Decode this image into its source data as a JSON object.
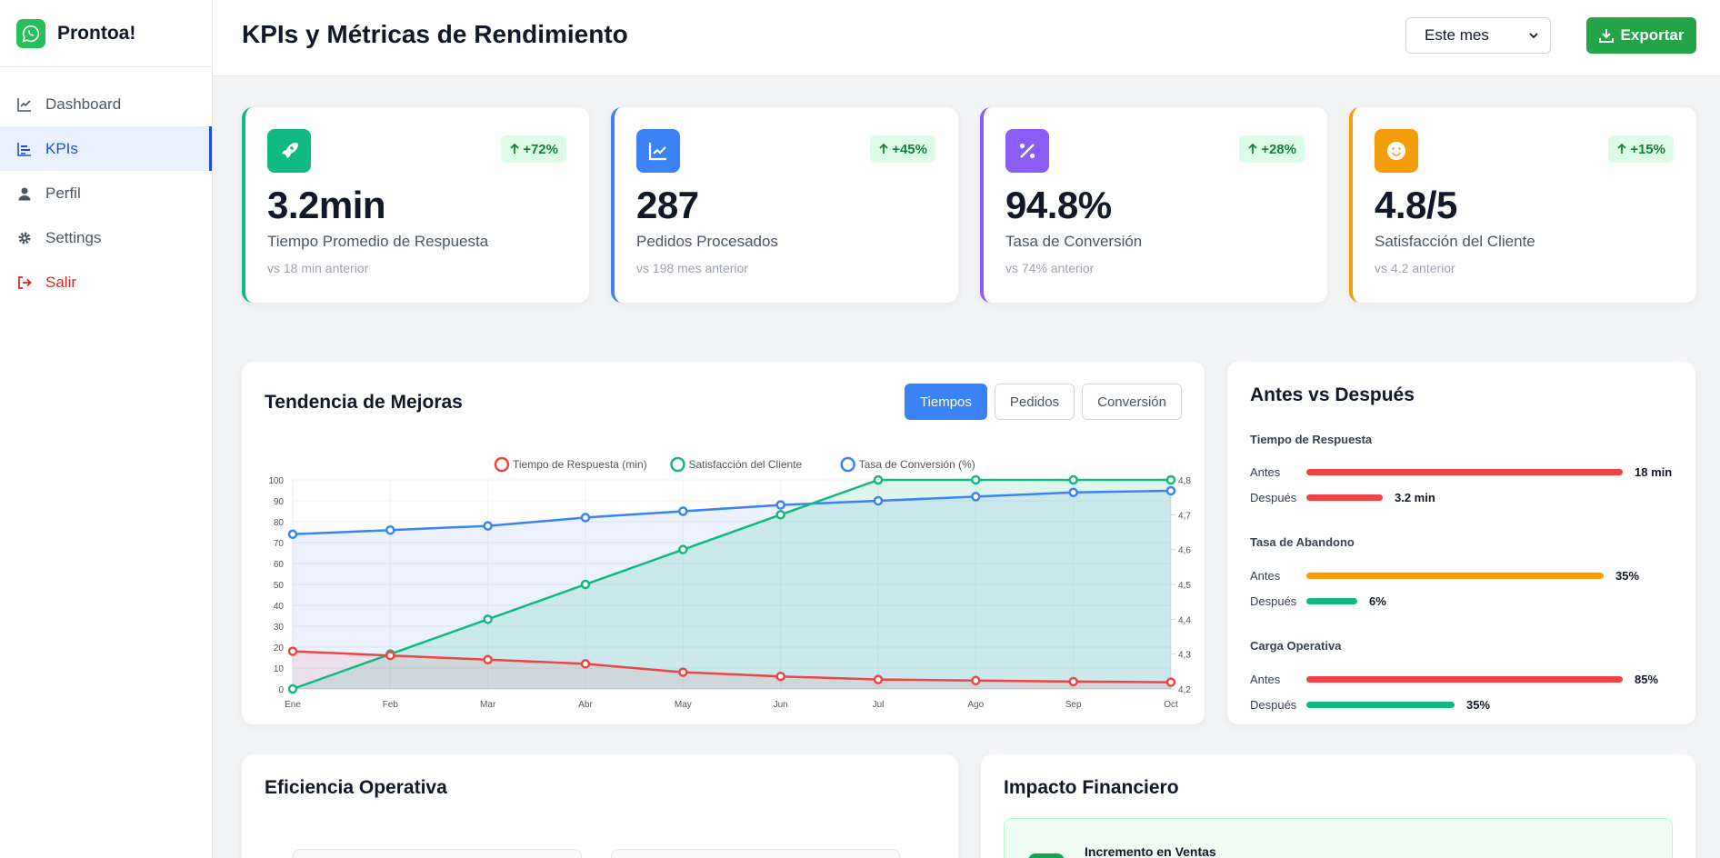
{
  "app": {
    "name": "Prontoa!"
  },
  "sidebar": {
    "items": [
      {
        "label": "Dashboard",
        "icon": "chart-line-icon",
        "active": false
      },
      {
        "label": "KPIs",
        "icon": "chart-bar-icon",
        "active": true
      },
      {
        "label": "Perfil",
        "icon": "user-icon",
        "active": false
      },
      {
        "label": "Settings",
        "icon": "gear-icon",
        "active": false
      },
      {
        "label": "Salir",
        "icon": "sign-out-icon",
        "active": false
      }
    ]
  },
  "header": {
    "title": "KPIs y Métricas de Rendimiento",
    "period_selected": "Este mes",
    "export_label": "Exportar"
  },
  "kpis": [
    {
      "value": "3.2min",
      "label": "Tiempo Promedio de Respuesta",
      "sub": "vs 18 min anterior",
      "badge": "+72%",
      "icon": "rocket-icon",
      "color": "#10b981"
    },
    {
      "value": "287",
      "label": "Pedidos Procesados",
      "sub": "vs 198 mes anterior",
      "badge": "+45%",
      "icon": "chart-line-icon",
      "color": "#3b82f6"
    },
    {
      "value": "94.8%",
      "label": "Tasa de Conversión",
      "sub": "vs 74% anterior",
      "badge": "+28%",
      "icon": "percent-icon",
      "color": "#8b5cf6"
    },
    {
      "value": "4.8/5",
      "label": "Satisfacción del Cliente",
      "sub": "vs 4.2 anterior",
      "badge": "+15%",
      "icon": "smile-icon",
      "color": "#f59e0b"
    }
  ],
  "trend": {
    "title": "Tendencia de Mejoras",
    "tabs": [
      "Tiempos",
      "Pedidos",
      "Conversión"
    ],
    "active_tab": "Tiempos"
  },
  "chart_data": {
    "type": "line",
    "categories": [
      "Ene",
      "Feb",
      "Mar",
      "Abr",
      "May",
      "Jun",
      "Jul",
      "Ago",
      "Sep",
      "Oct"
    ],
    "series": [
      {
        "name": "Tiempo de Respuesta (min)",
        "axis": "left",
        "color": "#ef4444",
        "values": [
          18,
          16,
          14,
          12,
          8,
          6,
          4.5,
          4,
          3.5,
          3.2
        ]
      },
      {
        "name": "Satisfacción del Cliente",
        "axis": "right",
        "color": "#10b981",
        "values": [
          4.2,
          4.3,
          4.4,
          4.5,
          4.6,
          4.7,
          4.8,
          4.8,
          4.8,
          4.8
        ]
      },
      {
        "name": "Tasa de Conversión (%)",
        "axis": "left",
        "color": "#3b82f6",
        "values": [
          74,
          76,
          78,
          82,
          85,
          88,
          90,
          92,
          94,
          94.8
        ]
      }
    ],
    "y_left": {
      "ticks": [
        "0",
        "10",
        "20",
        "30",
        "40",
        "50",
        "60",
        "70",
        "80",
        "90",
        "100"
      ],
      "ylim": [
        0,
        100
      ]
    },
    "y_right": {
      "ticks": [
        "4,2",
        "4,3",
        "4,4",
        "4,5",
        "4,6",
        "4,7",
        "4,8"
      ],
      "ylim": [
        4.2,
        4.8
      ]
    },
    "legend": "top-center",
    "grid": true
  },
  "comparison": {
    "title": "Antes vs Después",
    "sections": [
      {
        "label": "Tiempo de Respuesta",
        "before": {
          "label": "Antes",
          "value": "18 min",
          "fraction": 1.0,
          "color": "#ef4444"
        },
        "after": {
          "label": "Después",
          "value": "3.2 min",
          "fraction": 0.24,
          "color": "#ef4444"
        }
      },
      {
        "label": "Tasa de Abandono",
        "before": {
          "label": "Antes",
          "value": "35%",
          "fraction": 0.94,
          "color": "#f59e0b"
        },
        "after": {
          "label": "Después",
          "value": "6%",
          "fraction": 0.16,
          "color": "#10b981"
        }
      },
      {
        "label": "Carga Operativa",
        "before": {
          "label": "Antes",
          "value": "85%",
          "fraction": 1.0,
          "color": "#ef4444"
        },
        "after": {
          "label": "Después",
          "value": "35%",
          "fraction": 0.47,
          "color": "#10b981"
        }
      }
    ]
  },
  "efficiency": {
    "title": "Eficiencia Operativa"
  },
  "financial": {
    "title": "Impacto Financiero",
    "first_item_label": "Incremento en Ventas"
  }
}
